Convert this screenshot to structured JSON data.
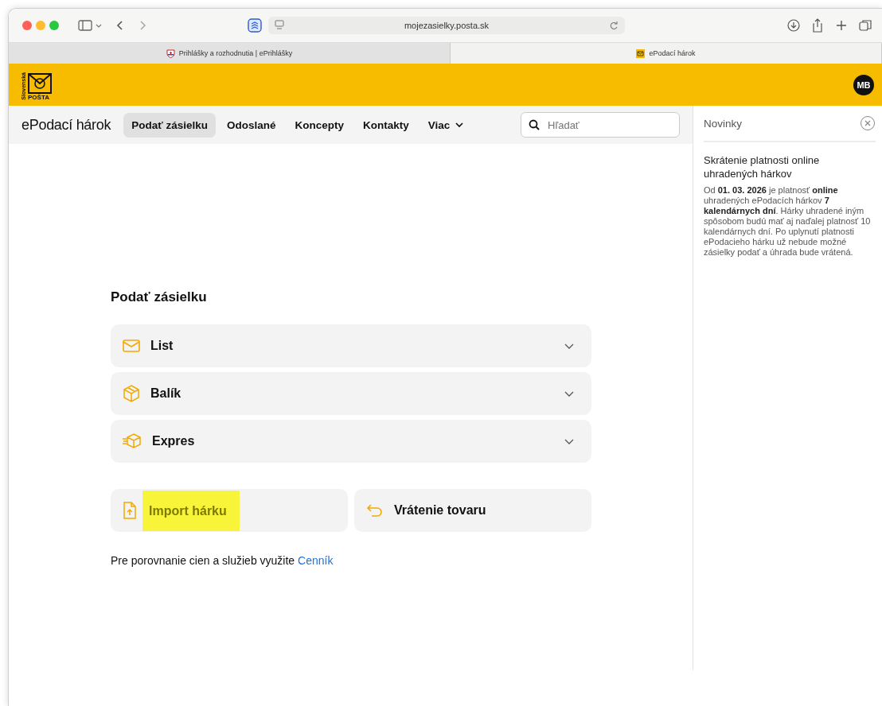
{
  "browser": {
    "address": "mojezasielky.posta.sk",
    "tabs": [
      {
        "title": "Prihlášky a rozhodnutia | ePrihlášky",
        "selected": false,
        "kind": "flag"
      },
      {
        "title": "ePodací hárok",
        "selected": true,
        "kind": "post"
      }
    ]
  },
  "header": {
    "logo_small": "Slovenská",
    "logo_word": "POŠTA",
    "avatar": "MB"
  },
  "nav": {
    "brand": "ePodací hárok",
    "items": [
      {
        "label": "Podať zásielku",
        "selected": true,
        "kind": "link"
      },
      {
        "label": "Odoslané",
        "selected": false,
        "kind": "link"
      },
      {
        "label": "Koncepty",
        "selected": false,
        "kind": "link"
      },
      {
        "label": "Kontakty",
        "selected": false,
        "kind": "link"
      },
      {
        "label": "Viac",
        "selected": false,
        "kind": "dropdown"
      }
    ],
    "search": {
      "placeholder": "Hľadať"
    }
  },
  "main": {
    "title": "Podať zásielku",
    "categories": [
      {
        "label": "List",
        "expanded": false,
        "kind": "letter"
      },
      {
        "label": "Balík",
        "expanded": false,
        "kind": "parcel"
      },
      {
        "label": "Expres",
        "expanded": false,
        "kind": "express"
      }
    ],
    "actions": [
      {
        "label": "Import hárku",
        "highlighted": true,
        "kind": "import"
      },
      {
        "label": "Vrátenie tovaru",
        "highlighted": false,
        "kind": "return"
      }
    ],
    "footer": {
      "text": "Pre porovnanie cien a služieb využite",
      "link": "Cenník"
    }
  },
  "news": {
    "title": "Novinky",
    "items": [
      {
        "heading": "Skrátenie platnosti online uhradených hárkov",
        "body": "Od **01. 03. 2026** je platnosť **online** uhradených ePodacích hárkov **7 kalendárnych dní**. Hárky uhradené iným spôsobom budú mať aj naďalej platnosť 10 kalendárnych dní. Po uplynutí platnosti ePodacieho hárku už nebude možné zásielky podať a úhrada bude vrátená."
      }
    ]
  }
}
